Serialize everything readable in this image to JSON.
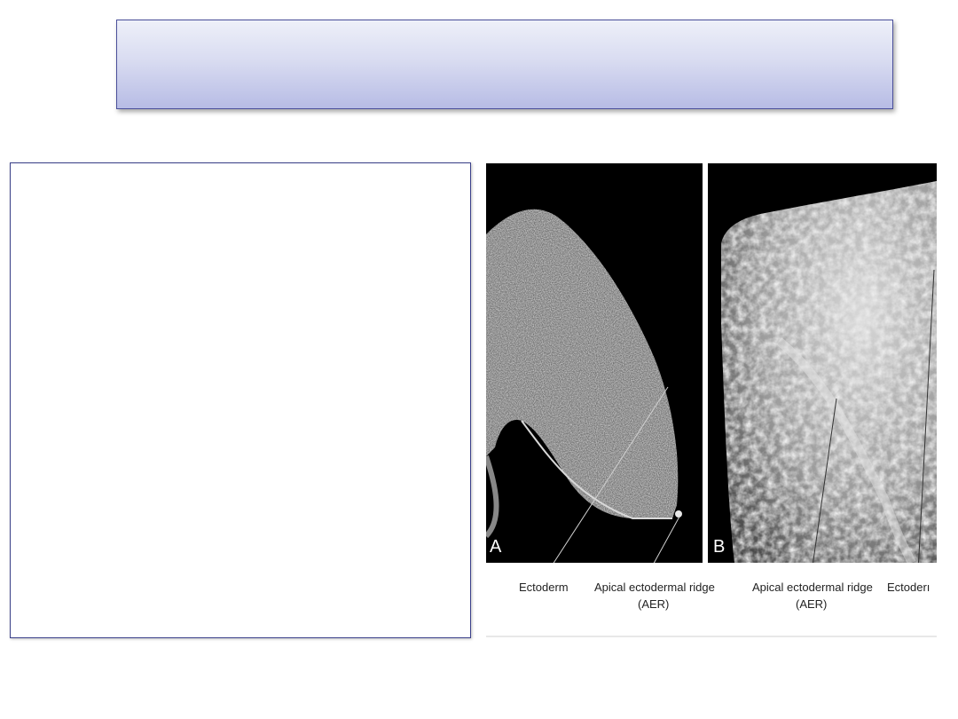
{
  "slide": {
    "title": "",
    "body_text": ""
  },
  "figure": {
    "panel_a": {
      "letter": "A",
      "labels": [
        "Ectoderm",
        "Apical ectodermal ridge",
        "(AER)"
      ]
    },
    "panel_b": {
      "letter": "B",
      "labels": [
        "Apical ectodermal ridge",
        "(AER)",
        "Ectoderı"
      ]
    }
  }
}
